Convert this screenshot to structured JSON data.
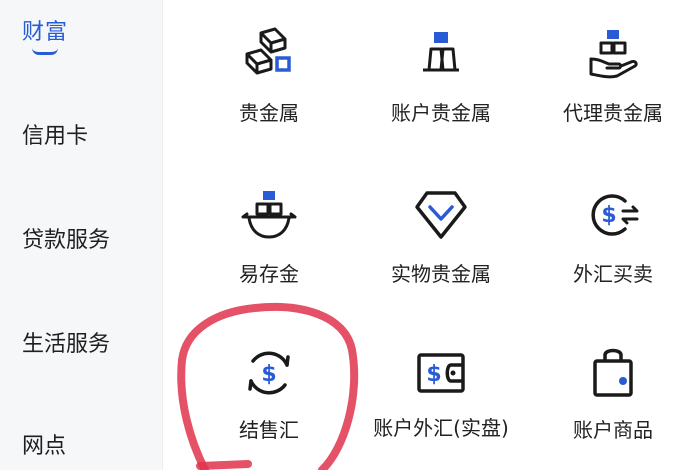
{
  "sidebar": {
    "active": "财富",
    "items": [
      "信用卡",
      "贷款服务",
      "生活服务",
      "网点"
    ]
  },
  "grid": {
    "items": [
      {
        "label": "贵金属",
        "icon": "gold-bars-icon"
      },
      {
        "label": "账户贵金属",
        "icon": "stacked-gold-icon"
      },
      {
        "label": "代理贵金属",
        "icon": "gold-in-hand-icon"
      },
      {
        "label": "易存金",
        "icon": "gold-in-bowl-icon"
      },
      {
        "label": "实物贵金属",
        "icon": "diamond-icon"
      },
      {
        "label": "外汇买卖",
        "icon": "currency-exchange-icon"
      },
      {
        "label": "结售汇",
        "icon": "dollar-exchange-icon"
      },
      {
        "label": "账户外汇(实盘)",
        "icon": "dollar-wallet-icon"
      },
      {
        "label": "账户商品",
        "icon": "shopping-bag-icon"
      }
    ]
  },
  "colors": {
    "accent": "#2a5bd7",
    "icon_stroke": "#1a1a1a",
    "annotation": "#e0324b"
  }
}
